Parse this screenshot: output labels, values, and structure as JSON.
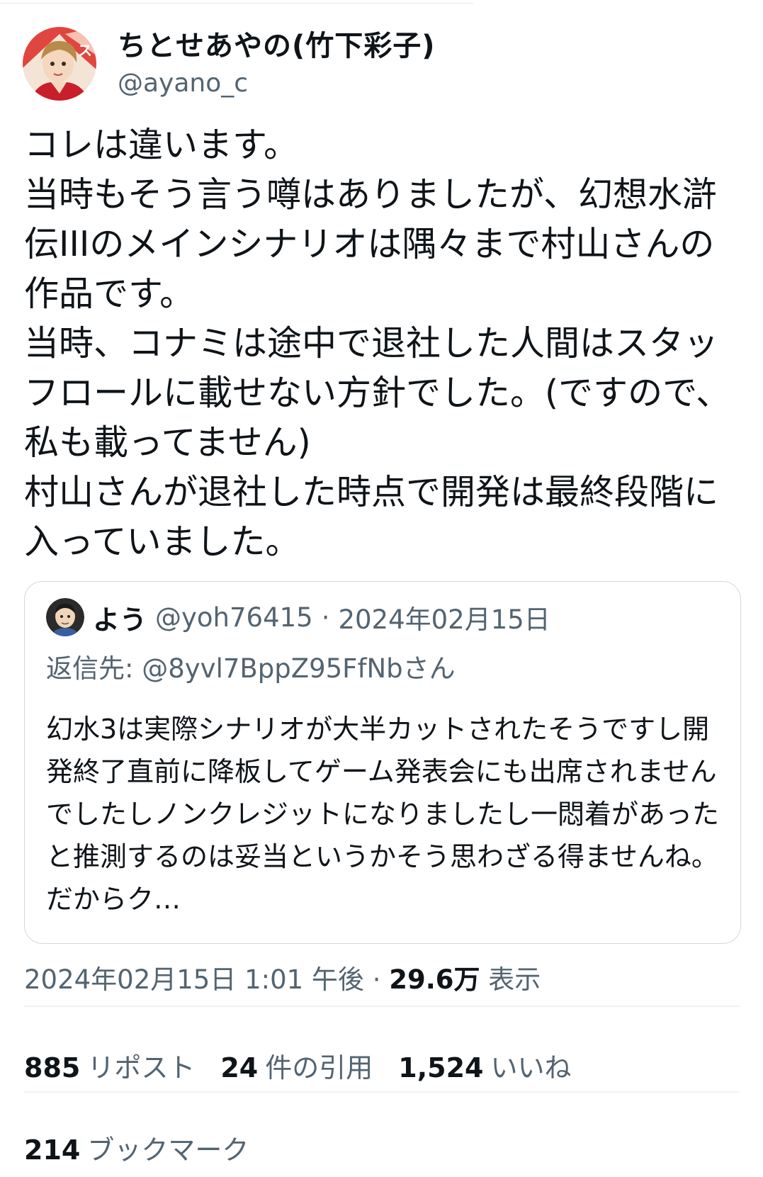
{
  "author": {
    "display_name": "ちとせあやの(竹下彩子)",
    "handle": "@ayano_c"
  },
  "tweet": {
    "text": "コレは違います。\n当時もそう言う噂はありましたが、幻想水滸伝IIIのメインシナリオは隅々まで村山さんの作品です。\n当時、コナミは途中で退社した人間はスタッフロールに載せない方針でした。(ですので、私も載ってません)\n村山さんが退社した時点で開発は最終段階に入っていました。"
  },
  "quote": {
    "display_name": "よう",
    "handle": "@yoh76415",
    "separator": "·",
    "date": "2024年02月15日",
    "reply_label": "返信先:",
    "reply_to": "@8yvl7BppZ95FfNbさん",
    "text": "幻水3は実際シナリオが大半カットされたそうですし開発終了直前に降板してゲーム発表会にも出席されませんでしたしノンクレジットになりましたし一悶着があったと推測するのは妥当というかそう思わざる得ませんね。だからク…"
  },
  "meta": {
    "timestamp": "2024年02月15日 1:01 午後",
    "separator": "·",
    "views_count": "29.6万",
    "views_label": "表示"
  },
  "stats": {
    "reposts_count": "885",
    "reposts_label": "リポスト",
    "quotes_count": "24",
    "quotes_label": "件の引用",
    "likes_count": "1,524",
    "likes_label": "いいね",
    "bookmarks_count": "214",
    "bookmarks_label": "ブックマーク"
  },
  "colors": {
    "text_primary": "#0f1419",
    "text_secondary": "#536471",
    "border": "#cfd9de",
    "avatar_accent": "#d8262c"
  },
  "icons": {
    "author_avatar": "anime-portrait-avatar",
    "quote_avatar": "cartoon-face-avatar"
  }
}
